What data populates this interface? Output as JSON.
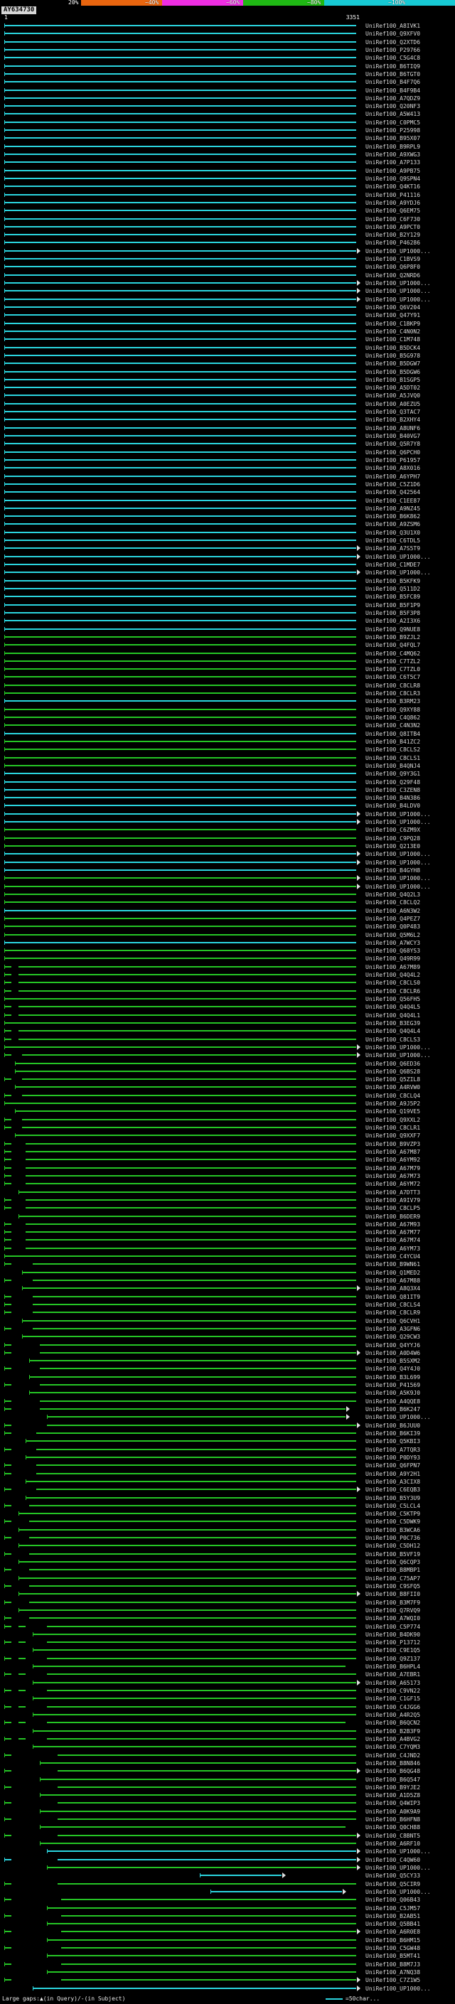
{
  "chart_data": {
    "type": "bar",
    "orientation": "horizontal",
    "title": "AY634730",
    "query": {
      "name": "AY634730",
      "start": "1",
      "end": "3351"
    },
    "identity_scale": {
      "labels": [
        "20%",
        "~40%",
        "~60%",
        "~80%",
        "~100%"
      ],
      "colors": [
        "#000000",
        "#e8650f",
        "#ee2ee2",
        "#1fb814",
        "#17c9d4"
      ]
    },
    "bar_colors": {
      "c": "#2bd5df",
      "g": "#25c525"
    },
    "arrow_color": "#e0e0e0",
    "label_prefix": "UniRef100_",
    "legend": {
      "left": "Large gaps:▲(in Query)/-(in Subject)",
      "right": "=50char..."
    },
    "rows": [
      [
        "A8IVK1",
        "c",
        "0-99",
        0
      ],
      [
        "Q9XFV0",
        "c",
        "0-99",
        0
      ],
      [
        "Q2XTD6",
        "c",
        "0-99",
        0
      ],
      [
        "P29766",
        "c",
        "0-99",
        0
      ],
      [
        "C5G4C8",
        "c",
        "0-99",
        0
      ],
      [
        "B6TIQ9",
        "c",
        "0-99",
        0
      ],
      [
        "B6TGT0",
        "c",
        "0-99",
        0
      ],
      [
        "B4F7Q6",
        "c",
        "0-99",
        0
      ],
      [
        "B4F9B4",
        "c",
        "0-99",
        0
      ],
      [
        "A7QDZ9",
        "c",
        "0-99",
        0
      ],
      [
        "Q20NF3",
        "c",
        "0-99",
        0
      ],
      [
        "A5W413",
        "c",
        "0-99",
        0
      ],
      [
        "C0PMC5",
        "c",
        "0-99",
        0
      ],
      [
        "P25998",
        "c",
        "0-99",
        0
      ],
      [
        "B95X07",
        "c",
        "0-99",
        0
      ],
      [
        "B9RPL9",
        "c",
        "0-99",
        0
      ],
      [
        "A9XWG3",
        "c",
        "0-99",
        0
      ],
      [
        "A7P133",
        "c",
        "0-99",
        0
      ],
      [
        "A9PB75",
        "c",
        "0-99",
        0
      ],
      [
        "Q9SPN4",
        "c",
        "0-99",
        0
      ],
      [
        "Q4KT16",
        "c",
        "0-99",
        0
      ],
      [
        "P41116",
        "c",
        "0-99",
        0
      ],
      [
        "A9YDJ6",
        "c",
        "0-99",
        0
      ],
      [
        "Q6EM75",
        "c",
        "0-99",
        0
      ],
      [
        "C6F730",
        "c",
        "0-99",
        0
      ],
      [
        "A9PCT0",
        "c",
        "0-99",
        0
      ],
      [
        "B2Y129",
        "c",
        "0-99",
        0
      ],
      [
        "P46286",
        "c",
        "0-99",
        0
      ],
      [
        "UP1000...",
        "c",
        "0-99",
        1
      ],
      [
        "C1BVS9",
        "c",
        "0-99",
        0
      ],
      [
        "Q6P8F0",
        "c",
        "0-99",
        0
      ],
      [
        "Q2NRD6",
        "c",
        "0-99",
        0
      ],
      [
        "UP1000...",
        "c",
        "0-99",
        1
      ],
      [
        "UP1000...",
        "c",
        "0-99",
        1
      ],
      [
        "UP1000...",
        "c",
        "0-99",
        1
      ],
      [
        "Q6V204",
        "c",
        "0-99",
        0
      ],
      [
        "Q47Y91",
        "c",
        "0-99",
        0
      ],
      [
        "C1BKP9",
        "c",
        "0-99",
        0
      ],
      [
        "C4N0N2",
        "c",
        "0-99",
        0
      ],
      [
        "C1M748",
        "c",
        "0-99",
        0
      ],
      [
        "B5DCK4",
        "c",
        "0-99",
        0
      ],
      [
        "B5G978",
        "c",
        "0-99",
        0
      ],
      [
        "B5DGW7",
        "c",
        "0-99",
        0
      ],
      [
        "B5DGW6",
        "c",
        "0-99",
        0
      ],
      [
        "B1SGP5",
        "c",
        "0-99",
        0
      ],
      [
        "A5DT02",
        "c",
        "0-99",
        0
      ],
      [
        "A5JVQ0",
        "c",
        "0-99",
        0
      ],
      [
        "A0EZU5",
        "c",
        "0-99",
        0
      ],
      [
        "Q3TAC7",
        "c",
        "0-99",
        0
      ],
      [
        "B2XHY4",
        "c",
        "0-99",
        0
      ],
      [
        "A8UNF6",
        "c",
        "0-99",
        0
      ],
      [
        "B40VG7",
        "c",
        "0-99",
        0
      ],
      [
        "Q5R7Y8",
        "c",
        "0-99",
        0
      ],
      [
        "Q6PCH0",
        "c",
        "0-99",
        0
      ],
      [
        "P61957",
        "c",
        "0-99",
        0
      ],
      [
        "A8X016",
        "c",
        "0-99",
        0
      ],
      [
        "A6YPH7",
        "c",
        "0-99",
        0
      ],
      [
        "C5Z1D6",
        "c",
        "0-99",
        0
      ],
      [
        "Q42564",
        "c",
        "0-99",
        0
      ],
      [
        "C1EE87",
        "c",
        "0-99",
        0
      ],
      [
        "A9NZ45",
        "c",
        "0-99",
        0
      ],
      [
        "B6K862",
        "c",
        "0-99",
        0
      ],
      [
        "A9ZSM6",
        "c",
        "0-99",
        0
      ],
      [
        "Q3U1X0",
        "c",
        "0-99",
        0
      ],
      [
        "C6TDL5",
        "c",
        "0-99",
        0
      ],
      [
        "A7S5T9",
        "c",
        "0-99",
        1
      ],
      [
        "UP1000...",
        "c",
        "0-99",
        1
      ],
      [
        "C1MDE7",
        "c",
        "0-99",
        0
      ],
      [
        "UP1000...",
        "c",
        "0-99",
        1
      ],
      [
        "B5KFK9",
        "c",
        "0-99",
        0
      ],
      [
        "Q511D2",
        "c",
        "0-99",
        0
      ],
      [
        "B5FC89",
        "c",
        "0-99",
        0
      ],
      [
        "B5F1P9",
        "c",
        "0-99",
        0
      ],
      [
        "B5F3P8",
        "c",
        "0-99",
        0
      ],
      [
        "A2I3X6",
        "c",
        "0-99",
        0
      ],
      [
        "Q9NUE8",
        "c",
        "0-99",
        0
      ],
      [
        "B9ZJL2",
        "g",
        "0-99",
        0
      ],
      [
        "Q4FQL7",
        "g",
        "0-99",
        0
      ],
      [
        "C4MQ62",
        "g",
        "0-99",
        0
      ],
      [
        "C7TZL2",
        "g",
        "0-99",
        0
      ],
      [
        "C7TZL0",
        "g",
        "0-99",
        0
      ],
      [
        "C6T5C7",
        "g",
        "0-99",
        0
      ],
      [
        "C8CLR8",
        "g",
        "0-99",
        0
      ],
      [
        "C8CLR3",
        "g",
        "0-99",
        0
      ],
      [
        "B3RM23",
        "c",
        "0-99",
        0
      ],
      [
        "Q9XY88",
        "g",
        "0-99",
        0
      ],
      [
        "C4Q862",
        "g",
        "0-99",
        0
      ],
      [
        "C4N3N2",
        "g",
        "0-99",
        0
      ],
      [
        "Q8ITB4",
        "c",
        "0-99",
        0
      ],
      [
        "B41ZC2",
        "g",
        "0-99",
        0
      ],
      [
        "C8CLS2",
        "g",
        "0-99",
        0
      ],
      [
        "C8CLS1",
        "g",
        "0-99",
        0
      ],
      [
        "B4QNJ4",
        "g",
        "0-99",
        0
      ],
      [
        "Q9Y3G1",
        "c",
        "0-99",
        0
      ],
      [
        "Q29F48",
        "c",
        "0-99",
        0
      ],
      [
        "C3ZEN8",
        "c",
        "0-99",
        0
      ],
      [
        "B4N386",
        "c",
        "0-99",
        0
      ],
      [
        "B4LDV0",
        "c",
        "0-99",
        0
      ],
      [
        "UP1000...",
        "c",
        "0-99",
        1
      ],
      [
        "UP1000...",
        "c",
        "0-99",
        1
      ],
      [
        "C6ZM9X",
        "g",
        "0-99",
        0
      ],
      [
        "C9PQ28",
        "g",
        "0-99",
        0
      ],
      [
        "Q213E0",
        "g",
        "0-99",
        0
      ],
      [
        "UP1000...",
        "c",
        "0-99",
        1
      ],
      [
        "UP1000...",
        "c",
        "0-99",
        1
      ],
      [
        "B4GYH8",
        "c",
        "0-99",
        0
      ],
      [
        "UP1000...",
        "g",
        "0-99",
        1
      ],
      [
        "UP1000...",
        "g",
        "0-99",
        1
      ],
      [
        "Q4Q2L3",
        "g",
        "0-99",
        0
      ],
      [
        "C8CLQ2",
        "g",
        "0-99",
        0
      ],
      [
        "A6N3W2",
        "c",
        "0-99",
        0
      ],
      [
        "Q4PEZ7",
        "g",
        "0-99",
        0
      ],
      [
        "Q0P483",
        "g",
        "0-99",
        0
      ],
      [
        "Q5M6L2",
        "g",
        "0-99",
        0
      ],
      [
        "A7WCY3",
        "c",
        "0-99",
        0
      ],
      [
        "Q68YS3",
        "g",
        "0-99",
        0
      ],
      [
        "Q49R99",
        "g",
        "0-99",
        0
      ],
      [
        "A67M89",
        "g",
        "0-2,4-99",
        0
      ],
      [
        "Q4Q4L2",
        "g",
        "0-2,4-99",
        0
      ],
      [
        "C8CLS0",
        "g",
        "0-2,4-99",
        0
      ],
      [
        "C8CLR6",
        "g",
        "0-2,4-99",
        0
      ],
      [
        "Q56FH5",
        "g",
        "0-99",
        0
      ],
      [
        "Q4Q4L5",
        "g",
        "0-2,4-99",
        0
      ],
      [
        "Q4Q4L1",
        "g",
        "0-2,4-99",
        0
      ],
      [
        "B3EG39",
        "g",
        "0-99",
        0
      ],
      [
        "Q4Q4L4",
        "g",
        "0-2,4-99",
        0
      ],
      [
        "C8CLS3",
        "g",
        "0-2,4-99",
        0
      ],
      [
        "UP1000...",
        "g",
        "0-99",
        1
      ],
      [
        "UP1000...",
        "g",
        "0-2,5-99",
        1
      ],
      [
        "Q6ED36",
        "g",
        "3-99",
        0
      ],
      [
        "Q6BS28",
        "g",
        "3-99",
        0
      ],
      [
        "Q5ZIL8",
        "g",
        "0-2,5-99",
        0
      ],
      [
        "A4RVW0",
        "g",
        "3-99",
        0
      ],
      [
        "C8CLQ4",
        "g",
        "0-2,5-99",
        0
      ],
      [
        "A9J5P2",
        "g",
        "0-99",
        0
      ],
      [
        "Q19VE5",
        "g",
        "3-99",
        0
      ],
      [
        "Q9XXL2",
        "g",
        "0-2,5-99",
        0
      ],
      [
        "C8CLR1",
        "g",
        "0-2,5-99",
        0
      ],
      [
        "Q9XXF7",
        "g",
        "3-99",
        0
      ],
      [
        "B9VZP3",
        "g",
        "0-2,6-99",
        0
      ],
      [
        "A67M87",
        "g",
        "0-2,6-99",
        0
      ],
      [
        "A6YM92",
        "g",
        "0-2,6-99",
        0
      ],
      [
        "A67M79",
        "g",
        "0-2,6-99",
        0
      ],
      [
        "A67M73",
        "g",
        "0-2,6-99",
        0
      ],
      [
        "A6YM72",
        "g",
        "0-2,6-99",
        0
      ],
      [
        "A7DTT3",
        "g",
        "4-99",
        0
      ],
      [
        "A9IV79",
        "g",
        "0-2,6-99",
        0
      ],
      [
        "C8CLP5",
        "g",
        "0-2,6-99",
        0
      ],
      [
        "B6DER9",
        "g",
        "4-99",
        0
      ],
      [
        "A67M93",
        "g",
        "0-2,6-99",
        0
      ],
      [
        "A67M77",
        "g",
        "0-2,6-99",
        0
      ],
      [
        "A67M74",
        "g",
        "0-2,6-99",
        0
      ],
      [
        "A6YM73",
        "g",
        "0-2,6-99",
        0
      ],
      [
        "C4YCU4",
        "g",
        "0-99",
        0
      ],
      [
        "B9WN61",
        "g",
        "0-2,8-99",
        0
      ],
      [
        "Q1MED2",
        "g",
        "5-99",
        0
      ],
      [
        "A67M88",
        "g",
        "0-2,8-99",
        0
      ],
      [
        "A8Q3X4",
        "g",
        "5-99",
        1
      ],
      [
        "Q81IT9",
        "g",
        "0-2,8-99",
        0
      ],
      [
        "C8CLS4",
        "g",
        "0-2,8-99",
        0
      ],
      [
        "C8CLR9",
        "g",
        "0-2,8-99",
        0
      ],
      [
        "Q6CVH1",
        "g",
        "5-99",
        0
      ],
      [
        "A3GFN6",
        "g",
        "0-2,8-99",
        0
      ],
      [
        "Q29CW3",
        "g",
        "5-99",
        0
      ],
      [
        "Q4YYJ6",
        "g",
        "0-2,10-99",
        0
      ],
      [
        "A0D4W6",
        "g",
        "0-2,10-99",
        1
      ],
      [
        "B5SXM2",
        "g",
        "7-99",
        0
      ],
      [
        "Q4Y4J0",
        "g",
        "0-2,10-99",
        0
      ],
      [
        "B3L699",
        "g",
        "7-99",
        0
      ],
      [
        "P41569",
        "g",
        "0-2,10-99",
        0
      ],
      [
        "A5K9J0",
        "g",
        "7-99",
        0
      ],
      [
        "A4QQE8",
        "g",
        "0-2,10-99",
        0
      ],
      [
        "B6K247",
        "g",
        "0-2,10-96",
        1
      ],
      [
        "UP1000...",
        "g",
        "12-96",
        1
      ],
      [
        "B6JUU0",
        "g",
        "0-2,12-99",
        1
      ],
      [
        "B6KI39",
        "g",
        "0-2,9-99",
        0
      ],
      [
        "Q5KBI3",
        "g",
        "6-99",
        0
      ],
      [
        "A7TQR3",
        "g",
        "0-2,9-99",
        0
      ],
      [
        "P0DY93",
        "g",
        "6-99",
        0
      ],
      [
        "Q6FPN7",
        "g",
        "0-2,9-99",
        0
      ],
      [
        "A9Y2H1",
        "g",
        "0-2,9-99",
        0
      ],
      [
        "A3CIX8",
        "g",
        "6-99",
        0
      ],
      [
        "C6EQB3",
        "g",
        "0-2,9-99",
        1
      ],
      [
        "B5Y3U9",
        "g",
        "6-99",
        0
      ],
      [
        "C5LCL4",
        "g",
        "0-2,7-99",
        0
      ],
      [
        "C5KTP9",
        "g",
        "4-99",
        0
      ],
      [
        "C5DWK9",
        "g",
        "0-2,7-99",
        0
      ],
      [
        "B3WCA6",
        "g",
        "4-99",
        0
      ],
      [
        "P0C736",
        "g",
        "0-2,7-99",
        0
      ],
      [
        "C5DH12",
        "g",
        "4-99",
        0
      ],
      [
        "B5VF19",
        "g",
        "0-2,7-99",
        0
      ],
      [
        "Q6CQP3",
        "g",
        "4-99",
        0
      ],
      [
        "B8MBP1",
        "g",
        "0-2,7-99",
        0
      ],
      [
        "C75AP7",
        "g",
        "4-99",
        0
      ],
      [
        "C9SFQ5",
        "g",
        "0-2,7-99",
        0
      ],
      [
        "B8FII0",
        "g",
        "4-99",
        1
      ],
      [
        "B3M7F9",
        "g",
        "0-2,7-99",
        0
      ],
      [
        "Q7RVQ9",
        "g",
        "4-99",
        0
      ],
      [
        "A7WQI0",
        "g",
        "0-2,7-99",
        0
      ],
      [
        "C5P774",
        "g",
        "0-2,4-6,12-99",
        0
      ],
      [
        "B4DK90",
        "g",
        "8-99",
        0
      ],
      [
        "P13712",
        "g",
        "0-2,4-6,12-99",
        0
      ],
      [
        "C9E1Q5",
        "g",
        "8-99",
        0
      ],
      [
        "Q9Z137",
        "g",
        "0-2,4-6,12-99",
        0
      ],
      [
        "B6HPL4",
        "g",
        "8-96",
        0
      ],
      [
        "A7EBR1",
        "g",
        "0-2,4-6,12-99",
        0
      ],
      [
        "A65173",
        "g",
        "8-99",
        1
      ],
      [
        "C9VN22",
        "g",
        "0-2,4-6,12-99",
        0
      ],
      [
        "C1GF15",
        "g",
        "8-99",
        0
      ],
      [
        "C4JGG6",
        "g",
        "0-2,4-6,12-99",
        0
      ],
      [
        "A4R2Q5",
        "g",
        "8-99",
        0
      ],
      [
        "B6QCN2",
        "g",
        "0-2,4-6,12-96",
        0
      ],
      [
        "B2B3F9",
        "g",
        "8-99",
        0
      ],
      [
        "A4BVG2",
        "g",
        "0-2,4-6,12-99",
        0
      ],
      [
        "C7YQM3",
        "g",
        "8-99",
        0
      ],
      [
        "C4JND2",
        "g",
        "0-2,15-99",
        0
      ],
      [
        "B8N846",
        "g",
        "10-99",
        0
      ],
      [
        "B6QG48",
        "g",
        "0-2,15-99",
        1
      ],
      [
        "B6Q547",
        "g",
        "10-99",
        0
      ],
      [
        "B9YJE2",
        "g",
        "0-2,15-99",
        0
      ],
      [
        "A1D5Z8",
        "g",
        "10-99",
        0
      ],
      [
        "Q4WIP3",
        "g",
        "0-2,15-99",
        0
      ],
      [
        "A0K9A9",
        "g",
        "10-99",
        0
      ],
      [
        "B6HFN8",
        "g",
        "0-2,15-99",
        0
      ],
      [
        "Q0CH88",
        "g",
        "10-96",
        0
      ],
      [
        "C8BNT5",
        "g",
        "0-2,15-99",
        1
      ],
      [
        "A6RF10",
        "g",
        "10-99",
        0
      ],
      [
        "UP1000...",
        "c",
        "12-99",
        1
      ],
      [
        "C4QW60",
        "c",
        "0-2,15-99",
        1
      ],
      [
        "UP1000...",
        "g",
        "12-99",
        1
      ],
      [
        "Q5CY33",
        "c",
        "55-78",
        1
      ],
      [
        "Q5CIR9",
        "g",
        "0-2,15-99",
        0
      ],
      [
        "UP1000...",
        "c",
        "58-95",
        1
      ],
      [
        "Q06B43",
        "g",
        "0-2,16-99",
        0
      ],
      [
        "C5JM57",
        "g",
        "12-99",
        0
      ],
      [
        "B2AB51",
        "g",
        "0-2,16-99",
        0
      ],
      [
        "Q5BB41",
        "g",
        "12-99",
        0
      ],
      [
        "A6R0E8",
        "g",
        "0-2,16-99",
        1
      ],
      [
        "B6HM15",
        "g",
        "12-99",
        0
      ],
      [
        "C5GW48",
        "g",
        "0-2,16-99",
        0
      ],
      [
        "B5MT41",
        "g",
        "12-99",
        0
      ],
      [
        "B8M7J3",
        "g",
        "0-2,16-99",
        0
      ],
      [
        "A7NQ38",
        "g",
        "12-99",
        0
      ],
      [
        "C7Z1W5",
        "g",
        "0-2,16-99",
        1
      ],
      [
        "UP1000...",
        "c",
        "8-99",
        1
      ]
    ]
  }
}
